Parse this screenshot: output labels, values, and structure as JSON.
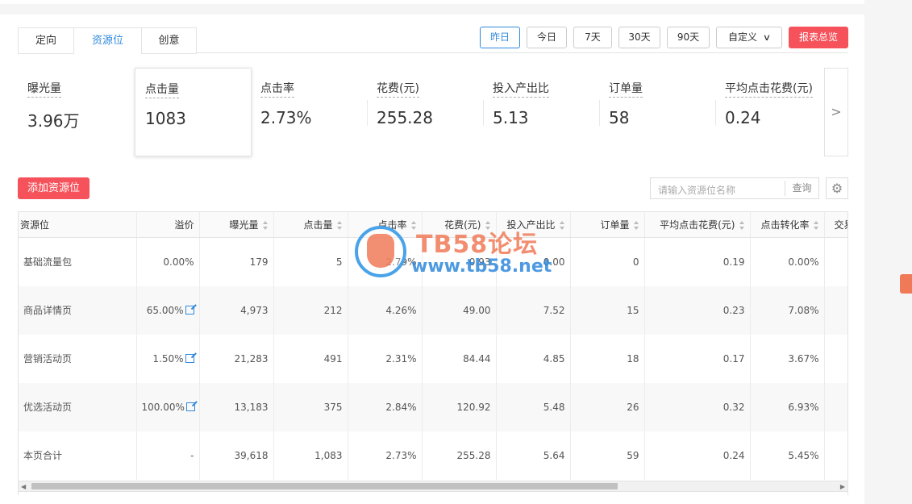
{
  "tabs": [
    {
      "label": "定向"
    },
    {
      "label": "资源位"
    },
    {
      "label": "创意"
    }
  ],
  "date_buttons": {
    "yesterday": "昨日",
    "today": "今日",
    "d7": "7天",
    "d30": "30天",
    "d90": "90天",
    "custom": "自定义",
    "report": "报表总览"
  },
  "metrics": [
    {
      "label": "曝光量",
      "value": "3.96万"
    },
    {
      "label": "点击量",
      "value": "1083"
    },
    {
      "label": "点击率",
      "value": "2.73%"
    },
    {
      "label": "花费(元)",
      "value": "255.28"
    },
    {
      "label": "投入产出比",
      "value": "5.13"
    },
    {
      "label": "订单量",
      "value": "58"
    },
    {
      "label": "平均点击花费(元)",
      "value": "0.24"
    }
  ],
  "toolbar": {
    "add_label": "添加资源位",
    "search_placeholder": "请输入资源位名称",
    "search_button": "查询"
  },
  "table": {
    "headers": [
      "资源位",
      "溢价",
      "曝光量",
      "点击量",
      "点击率",
      "花费(元)",
      "投入产出比",
      "订单量",
      "平均点击花费(元)",
      "点击转化率",
      "交易"
    ],
    "rows": [
      [
        "基础流量包",
        "0.00%",
        "179",
        "5",
        "2.79%",
        "0.93",
        "0.00",
        "0",
        "0.19",
        "0.00%"
      ],
      [
        "商品详情页",
        "65.00%",
        "4,973",
        "212",
        "4.26%",
        "49.00",
        "7.52",
        "15",
        "0.23",
        "7.08%"
      ],
      [
        "营销活动页",
        "1.50%",
        "21,283",
        "491",
        "2.31%",
        "84.44",
        "4.85",
        "18",
        "0.17",
        "3.67%"
      ],
      [
        "优选活动页",
        "100.00%",
        "13,183",
        "375",
        "2.84%",
        "120.92",
        "5.48",
        "26",
        "0.32",
        "6.93%"
      ],
      [
        "本页合计",
        "-",
        "39,618",
        "1,083",
        "2.73%",
        "255.28",
        "5.64",
        "59",
        "0.24",
        "5.45%"
      ]
    ]
  },
  "watermark": {
    "title": "TB58论坛",
    "url": "www.tb58.net"
  },
  "colors": {
    "accent": "#3089dc",
    "primary_red": "#f5525b"
  }
}
